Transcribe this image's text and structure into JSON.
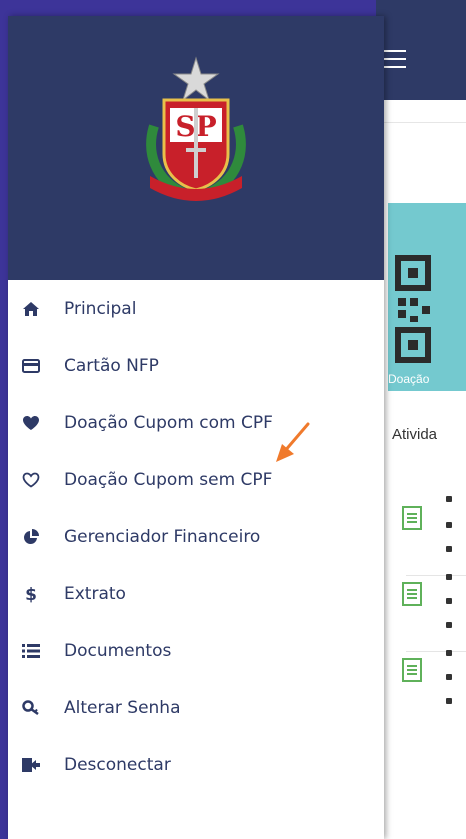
{
  "drawer": {
    "menu": [
      {
        "label": "Principal",
        "icon": "home-icon"
      },
      {
        "label": "Cartão NFP",
        "icon": "credit-card-icon"
      },
      {
        "label": "Doação Cupom com CPF",
        "icon": "heart-filled-icon"
      },
      {
        "label": "Doação Cupom sem CPF",
        "icon": "heart-outline-icon"
      },
      {
        "label": "Gerenciador Financeiro",
        "icon": "pie-chart-icon"
      },
      {
        "label": "Extrato",
        "icon": "dollar-icon"
      },
      {
        "label": "Documentos",
        "icon": "list-icon"
      },
      {
        "label": "Alterar Senha",
        "icon": "key-icon"
      },
      {
        "label": "Desconectar",
        "icon": "logout-icon"
      }
    ]
  },
  "main": {
    "card_label": "Doação",
    "section_title": "Ativida"
  },
  "colors": {
    "navy": "#2e3a66",
    "border": "#3d3499",
    "teal": "#74c9cf",
    "accent_arrow": "#f07a2c",
    "doc_green": "#5fb15a"
  }
}
